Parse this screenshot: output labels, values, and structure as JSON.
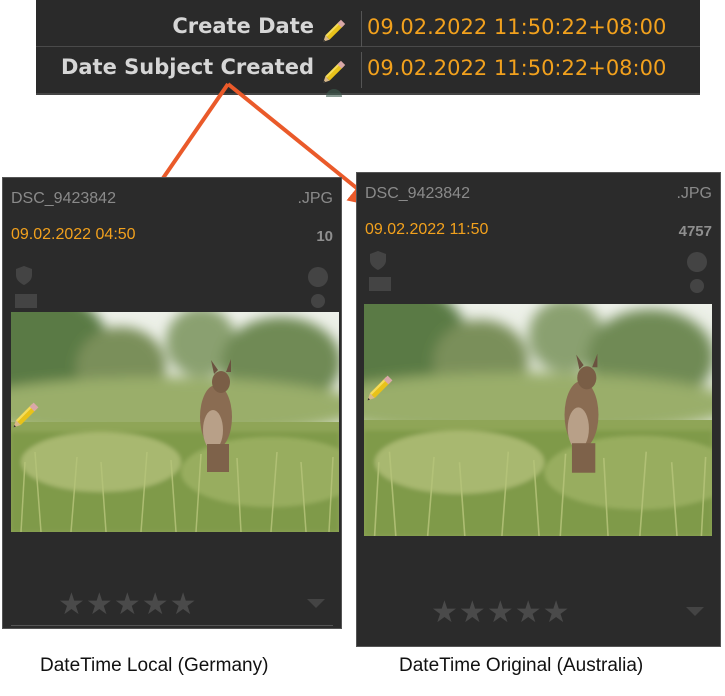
{
  "metadata_panel": {
    "rows": [
      {
        "label": "Create Date",
        "value": "09.02.2022 11:50:22+08:00",
        "icon": "pencil-icon"
      },
      {
        "label": "Date Subject Created",
        "value": "09.02.2022 11:50:22+08:00",
        "icon": "pencil-icon"
      }
    ]
  },
  "cards": {
    "left": {
      "filename": "DSC_9423842",
      "extension": ".JPG",
      "date": "09.02.2022 04:50",
      "count": "10",
      "rating": 0,
      "caption": "DateTime Local (Germany)"
    },
    "right": {
      "filename": "DSC_9423842",
      "extension": ".JPG",
      "date": "09.02.2022 11:50",
      "count": "4757",
      "rating": 0,
      "caption": "DateTime Original (Australia)"
    }
  },
  "colors": {
    "value_text": "#f2a11d",
    "arrow": "#ea5a2a",
    "panel_bg": "#2a2a2a"
  }
}
